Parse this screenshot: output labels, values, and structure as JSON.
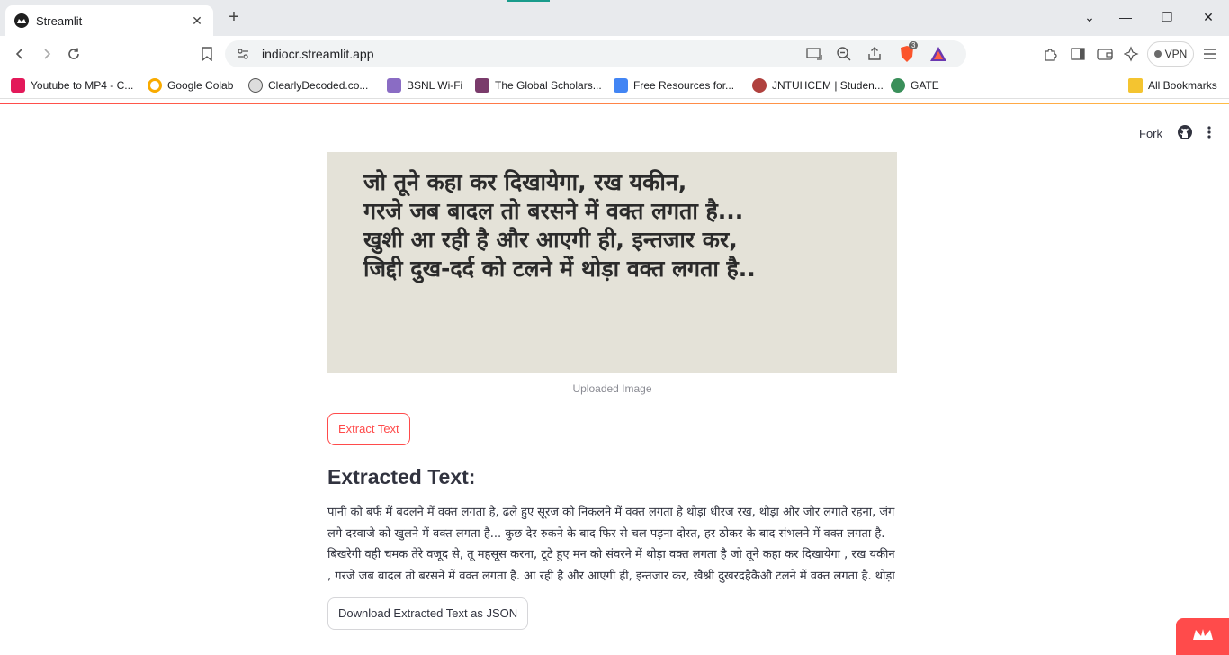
{
  "browser": {
    "tab_title": "Streamlit",
    "url": "indiocr.streamlit.app",
    "brave_badge": "3",
    "vpn_label": "VPN"
  },
  "bookmarks": [
    {
      "label": "Youtube to MP4 - C...",
      "color": "#e3195a"
    },
    {
      "label": "Google Colab",
      "color": "#f9ab00"
    },
    {
      "label": "ClearlyDecoded.co...",
      "color": "#555555"
    },
    {
      "label": "BSNL Wi-Fi",
      "color": "#8a6cc4"
    },
    {
      "label": "The Global Scholars...",
      "color": "#7a3b6b"
    },
    {
      "label": "Free Resources for...",
      "color": "#4285f4"
    },
    {
      "label": "JNTUHCEM | Studen...",
      "color": "#b0413e"
    },
    {
      "label": "GATE",
      "color": "#3a8f5a"
    }
  ],
  "all_bookmarks_label": "All Bookmarks",
  "app": {
    "fork_label": "Fork",
    "image_text_lines": [
      "जो तूने कहा कर दिखायेगा, रख यकीन,",
      "गरजे जब बादल तो बरसने में वक्त लगता है...",
      "खुशी आ रही है और आएगी ही, इन्तजार कर,",
      "जिद्दी दुख-दर्द को टलने में थोड़ा वक्त लगता है.."
    ],
    "image_caption": "Uploaded Image",
    "extract_button": "Extract Text",
    "extracted_heading": "Extracted Text:",
    "extracted_text": "पानी को बर्फ में बदलने में वक्त लगता है, ढले हुए सूरज को निकलने में वक्त लगता है थोड़ा धीरज रख, थोड़ा और जोर लगाते रहना, जंग लगे दरवाजे को खुलने में वक्त लगता है... कुछ देर रुकने के बाद फिर से चल पड़ना दोस्त, हर ठोकर के बाद संभलने में वक्त लगता है. बिखरेगी वही चमक तेरे वजूद से, तू महसूस करना, टूटे हुए मन को संवरने में थोड़ा वक्त लगता है जो तूने कहा कर दिखायेगा , रख यकीन , गरजे जब बादल तो बरसने में वक्त लगता है. आ रही है और आएगी ही, इन्तजार कर, खैश्री दुखरदहैकैऔ टलने में वक्त लगता है. थोड़ा",
    "download_button": "Download Extracted Text as JSON"
  },
  "colors": {
    "accent": "#ff4b4b",
    "text": "#31333f",
    "caption": "#8a8b93"
  }
}
